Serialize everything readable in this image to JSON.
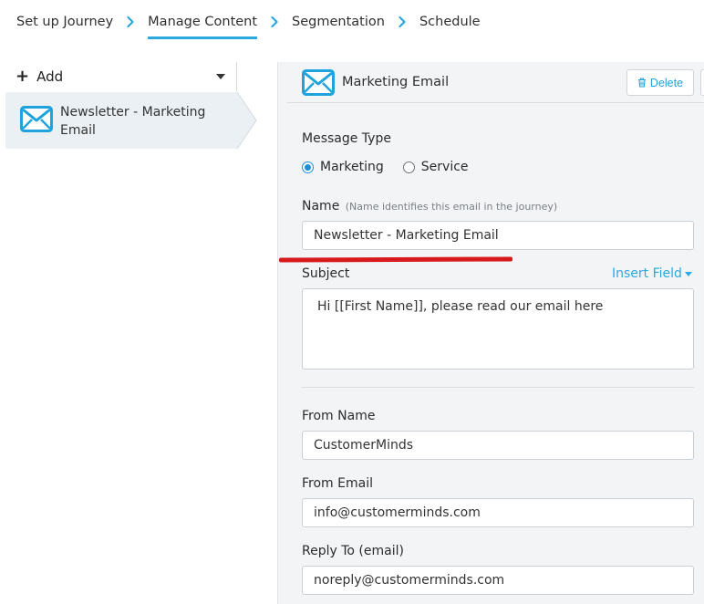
{
  "breadcrumb": {
    "steps": [
      {
        "label": "Set up Journey"
      },
      {
        "label": "Manage Content"
      },
      {
        "label": "Segmentation"
      },
      {
        "label": "Schedule"
      }
    ],
    "active_index": 1
  },
  "sidebar": {
    "add_label": "Add",
    "items": [
      {
        "title": "Newsletter - Marketing Email",
        "icon": "mail-icon"
      }
    ]
  },
  "editor": {
    "header_title": "Marketing Email",
    "delete_label": "Delete",
    "message_type": {
      "label": "Message Type",
      "options": [
        {
          "label": "Marketing",
          "checked": true
        },
        {
          "label": "Service",
          "checked": false
        }
      ]
    },
    "name": {
      "label": "Name",
      "hint": "(Name identifies this email in the journey)",
      "value": "Newsletter - Marketing Email"
    },
    "subject": {
      "label": "Subject",
      "insert_field_label": "Insert Field",
      "value": "Hi [[First Name]], please read our email here"
    },
    "from_name": {
      "label": "From Name",
      "value": "CustomerMinds"
    },
    "from_email": {
      "label": "From Email",
      "value": "info@customerminds.com"
    },
    "reply_to": {
      "label": "Reply To (email)",
      "value": "noreply@customerminds.com"
    }
  },
  "colors": {
    "accent": "#29a9e0",
    "annotation": "#d7191c",
    "selected_item_bg": "#ebf0f4"
  }
}
